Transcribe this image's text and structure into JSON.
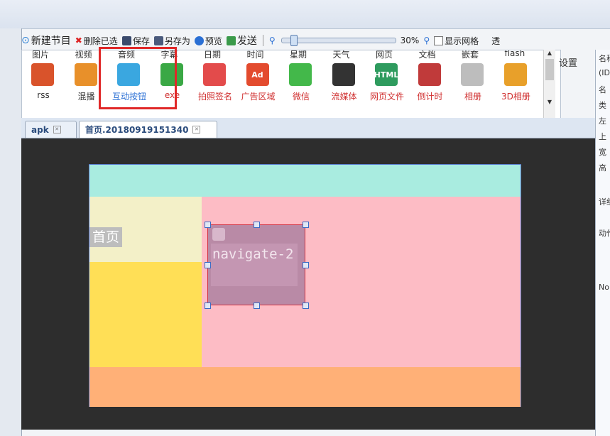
{
  "toolbar": {
    "new_program": "新建节目",
    "delete_selected": "删除已选",
    "save": "保存",
    "save_as": "另存为",
    "preview": "预览",
    "send": "发送",
    "zoom": "30%",
    "show_grid": "显示网格",
    "right_cut": "透"
  },
  "palette": {
    "top_labels": [
      "图片",
      "视频",
      "音频",
      "字幕",
      "日期",
      "时间",
      "星期",
      "天气",
      "网页",
      "文档",
      "嵌套",
      "flash"
    ],
    "items": [
      {
        "label": "rss",
        "color": "#d9532b"
      },
      {
        "label": "混播",
        "color": "#e8902a"
      },
      {
        "label": "互动按钮",
        "color": "#3aa7e0"
      },
      {
        "label": "exe",
        "color": "#3aa845"
      },
      {
        "label": "拍照签名",
        "color": "#e34b4b"
      },
      {
        "label": "广告区域",
        "color": "#e34b2e",
        "text": "Ad"
      },
      {
        "label": "微信",
        "color": "#43b84a"
      },
      {
        "label": "流媒体",
        "color": "#333333"
      },
      {
        "label": "网页文件",
        "color": "#2e9b5e",
        "text": "HTML"
      },
      {
        "label": "倒计时",
        "color": "#c03a3a"
      },
      {
        "label": "相册",
        "color": "#bdbdbd"
      },
      {
        "label": "3D相册",
        "color": "#e8a02a"
      }
    ],
    "settings": "设置"
  },
  "tabs": [
    {
      "label": "apk"
    },
    {
      "label": "首页.20180919151340"
    }
  ],
  "regions": {
    "home": "首页",
    "button_text": "navigate-2"
  },
  "colors": {
    "top_band": "#a9ece0",
    "left_upper": "#f3f0c8",
    "left_lower": "#ffdf56",
    "main_pink": "#fdbcc5",
    "bottom_band": "#ffb077",
    "selected_box": "#b98aa6"
  },
  "right_panel": {
    "lines": [
      "名称",
      "(ID",
      "名",
      "类",
      "左",
      "上",
      "宽",
      "高",
      "详细",
      "动作",
      "No"
    ]
  }
}
